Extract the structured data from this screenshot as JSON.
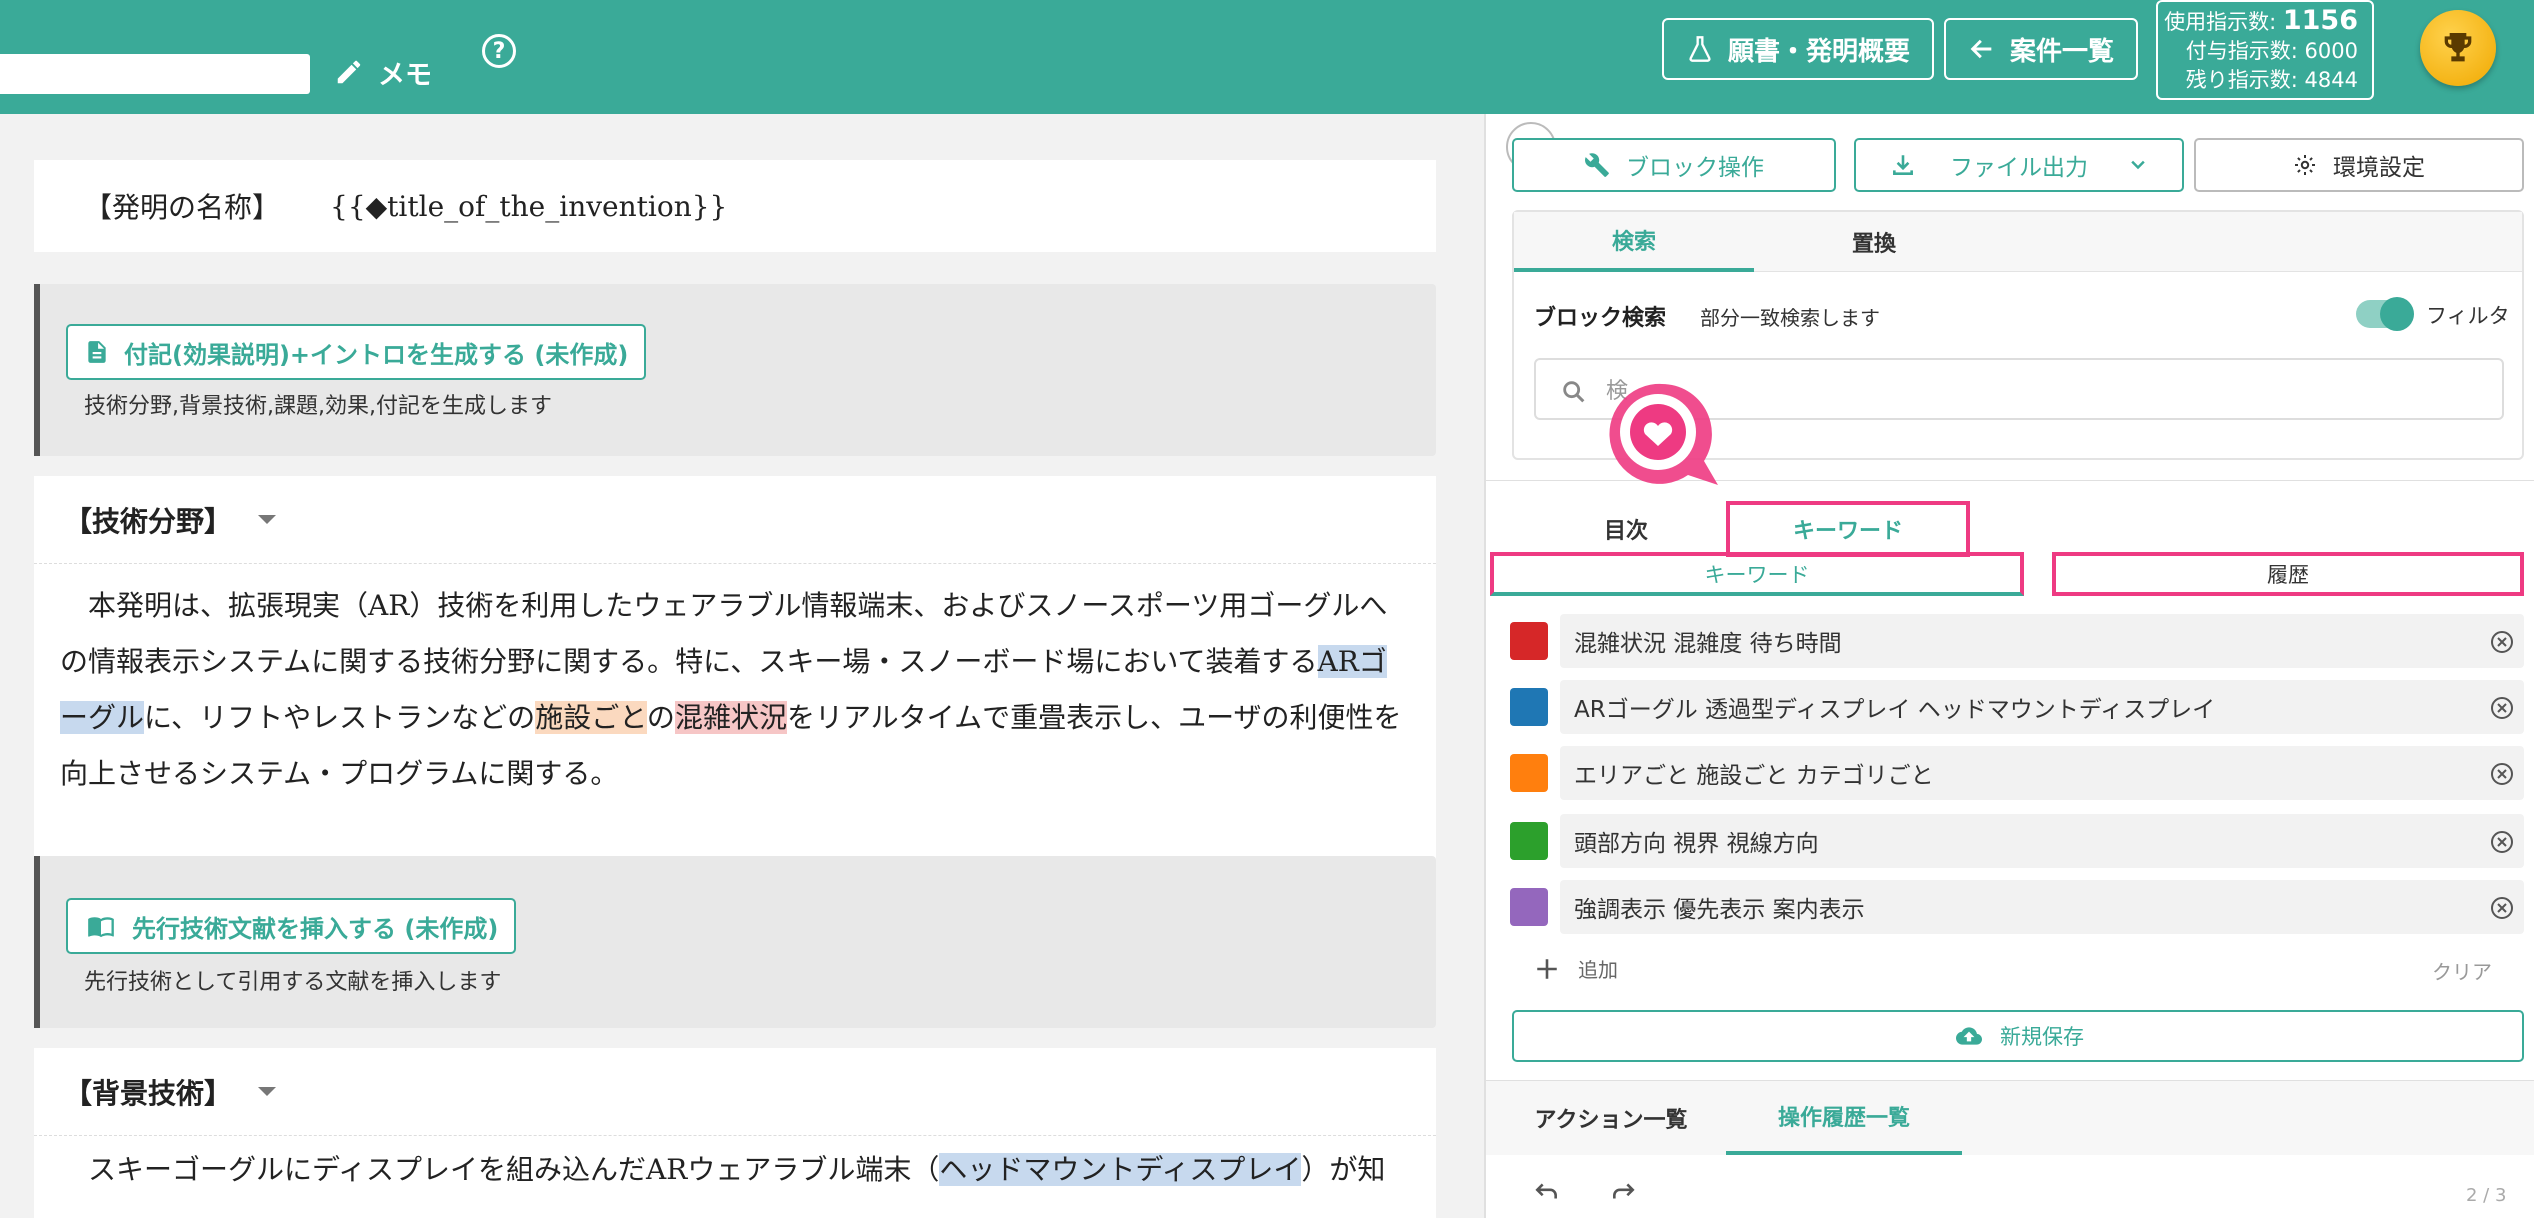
{
  "header": {
    "memo_label": "メモ",
    "help_icon": "?",
    "gansho_label": "願書・発明概要",
    "anken_label": "案件一覧",
    "usage": {
      "used_label": "使用指示数:",
      "used_value": "1156",
      "granted_label": "付与指示数:",
      "granted_value": "6000",
      "remaining_label": "残り指示数:",
      "remaining_value": "4844"
    }
  },
  "document": {
    "title_label": "【発明の名称】",
    "title_value": "{{◆title_of_the_invention}}",
    "gen1": {
      "button_label": "付記(効果説明)+イントロを生成する (未作成)",
      "description": "技術分野,背景技術,課題,効果,付記を生成します"
    },
    "section1": {
      "heading": "【技術分野】",
      "p1": "本発明は、拡張現実（AR）技術を利用したウェアラブル情報端末、およびスノースポーツ用ゴーグルへの情報表示システムに関する技術分野に関する。特に、スキー場・スノーボード場において装着する",
      "hl1": "ARゴーグル",
      "p2": "に、リフトやレストランなどの",
      "hl2": "施設ごと",
      "p3": "の",
      "hl3": "混雑状況",
      "p4": "をリアルタイムで重畳表示し、ユーザの利便性を向上させるシステム・プログラムに関する。"
    },
    "gen2": {
      "button_label": "先行技術文献を挿入する (未作成)",
      "description": "先行技術として引用する文献を挿入します"
    },
    "section2": {
      "heading": "【背景技術】",
      "p1": "スキーゴーグルにディスプレイを組み込んだARウェアラブル端末（",
      "hl1": "ヘッドマウントディスプレイ",
      "p2": "）が知"
    }
  },
  "panel": {
    "block_ops_label": "ブロック操作",
    "file_output_label": "ファイル出力",
    "env_settings_label": "環境設定",
    "search_tabs": [
      "検索",
      "置換"
    ],
    "block_search_label": "ブロック検索",
    "block_search_hint": "部分一致検索します",
    "filter_label": "フィルタ",
    "search_placeholder": "検",
    "top_tabs": [
      "目次",
      "キーワード"
    ],
    "sub_tabs": [
      "キーワード",
      "履歴"
    ],
    "keywords": [
      {
        "color": "#d62728",
        "text": "混雑状況 混雑度 待ち時間"
      },
      {
        "color": "#1f77b4",
        "text": "ARゴーグル 透過型ディスプレイ ヘッドマウントディスプレイ"
      },
      {
        "color": "#ff7f0e",
        "text": "エリアごと 施設ごと カテゴリごと"
      },
      {
        "color": "#2ca02c",
        "text": "頭部方向 視界 視線方向"
      },
      {
        "color": "#9467bd",
        "text": "強調表示 優先表示 案内表示"
      }
    ],
    "add_label": "追加",
    "clear_label": "クリア",
    "save_label": "新規保存",
    "action_tabs": [
      "アクション一覧",
      "操作履歴一覧"
    ],
    "page_indicator": "2 / 3"
  }
}
